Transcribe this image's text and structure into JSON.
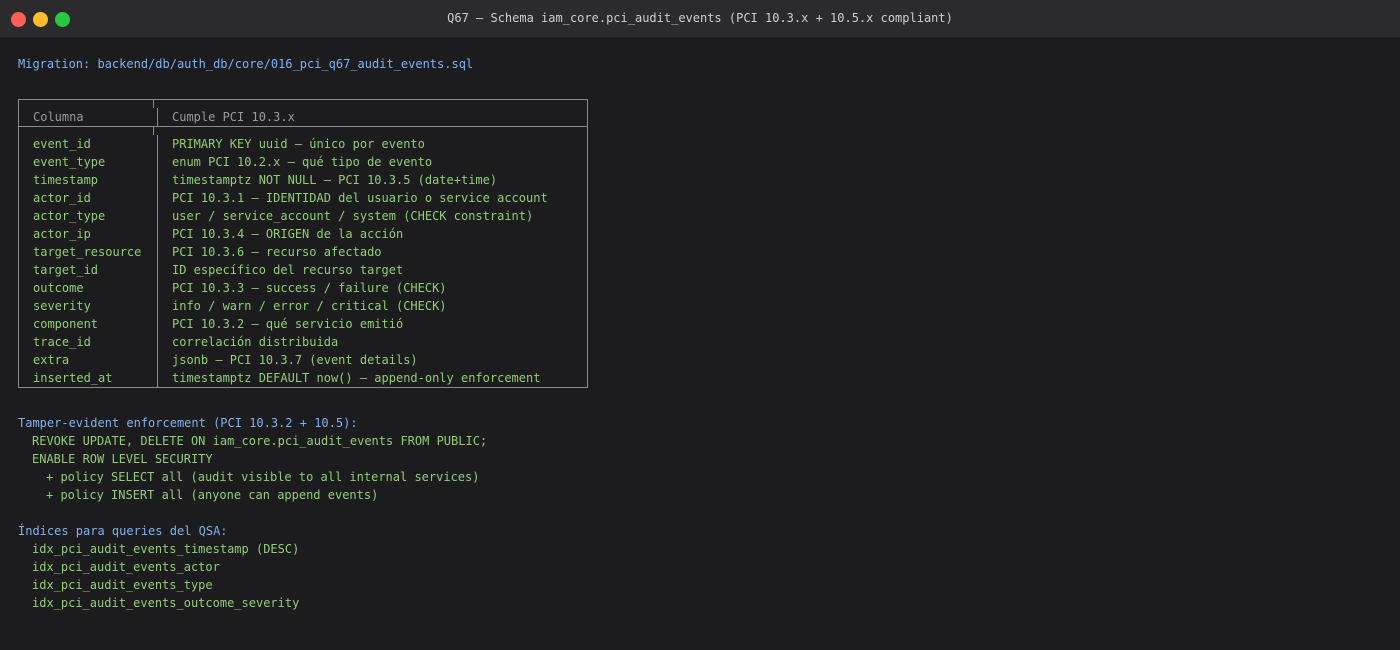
{
  "window": {
    "title": "Q67 — Schema iam_core.pci_audit_events (PCI 10.3.x + 10.5.x compliant)"
  },
  "migration_line": "Migration: backend/db/auth_db/core/016_pci_q67_audit_events.sql",
  "table": {
    "headers": [
      "Columna",
      "Cumple PCI 10.3.x"
    ],
    "rows": [
      [
        "event_id",
        "PRIMARY KEY uuid — único por evento"
      ],
      [
        "event_type",
        "enum PCI 10.2.x — qué tipo de evento"
      ],
      [
        "timestamp",
        "timestamptz NOT NULL — PCI 10.3.5 (date+time)"
      ],
      [
        "actor_id",
        "PCI 10.3.1 — IDENTIDAD del usuario o service account"
      ],
      [
        "actor_type",
        "user / service_account / system (CHECK constraint)"
      ],
      [
        "actor_ip",
        "PCI 10.3.4 — ORIGEN de la acción"
      ],
      [
        "target_resource",
        "PCI 10.3.6 — recurso afectado"
      ],
      [
        "target_id",
        "ID específico del recurso target"
      ],
      [
        "outcome",
        "PCI 10.3.3 — success / failure (CHECK)"
      ],
      [
        "severity",
        "info / warn / error / critical (CHECK)"
      ],
      [
        "component",
        "PCI 10.3.2 — qué servicio emitió"
      ],
      [
        "trace_id",
        "correlación distribuida"
      ],
      [
        "extra",
        "jsonb — PCI 10.3.7 (event details)"
      ],
      [
        "inserted_at",
        "timestamptz DEFAULT now() — append-only enforcement"
      ]
    ]
  },
  "tamper": {
    "heading": "Tamper-evident enforcement (PCI 10.3.2 + 10.5):",
    "lines": [
      "REVOKE UPDATE, DELETE ON iam_core.pci_audit_events FROM PUBLIC;",
      "ENABLE ROW LEVEL SECURITY"
    ],
    "sublines": [
      "+ policy SELECT all (audit visible to all internal services)",
      "+ policy INSERT all (anyone can append events)"
    ]
  },
  "indices": {
    "heading": "Índices para queries del QSA:",
    "items": [
      "idx_pci_audit_events_timestamp (DESC)",
      "idx_pci_audit_events_actor",
      "idx_pci_audit_events_type",
      "idx_pci_audit_events_outcome_severity"
    ]
  },
  "colors": {
    "background": "#1c1c1e",
    "blue": "#7eb1f0",
    "green": "#8fce73",
    "dim": "#9a9a9a"
  }
}
